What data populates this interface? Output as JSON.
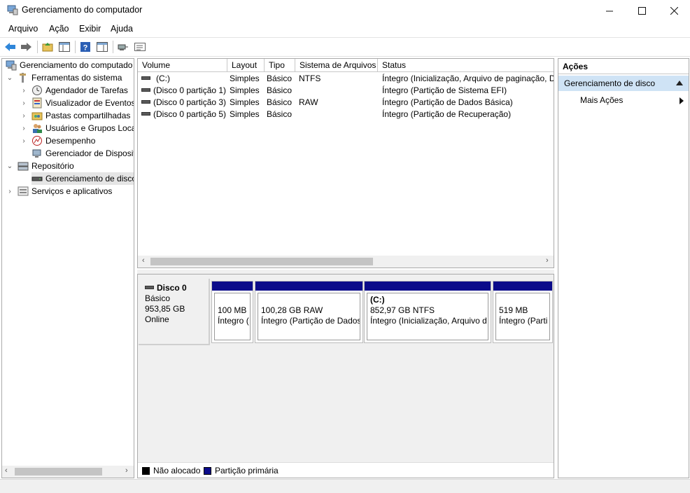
{
  "window": {
    "title": "Gerenciamento do computador",
    "controls": [
      "—",
      "☐",
      "✕"
    ]
  },
  "menu": [
    "Arquivo",
    "Ação",
    "Exibir",
    "Ajuda"
  ],
  "toolbar": {
    "icons": [
      "back-arrow-icon",
      "forward-arrow-icon",
      "up-folder-icon",
      "show-hide-tree-icon",
      "help-icon",
      "show-hide-action-pane-icon",
      "connect-icon",
      "properties-icon"
    ]
  },
  "tree": {
    "root": "Gerenciamento do computador (Local)",
    "root_visible": "Gerenciamento do computado",
    "system_tools": "Ferramentas do sistema",
    "items": [
      "Agendador de Tarefas",
      "Visualizador de Eventos",
      "Pastas compartilhadas",
      "Usuários e Grupos Loca",
      "Desempenho",
      "Gerenciador de Disposit"
    ],
    "storage": "Repositório",
    "disk_management": "Gerenciamento de disco",
    "services": "Serviços e aplicativos"
  },
  "volume_list": {
    "columns": [
      "Volume",
      "Layout",
      "Tipo",
      "Sistema de Arquivos",
      "Status"
    ],
    "rows": [
      [
        "(C:)",
        "Simples",
        "Básico",
        "NTFS",
        "Íntegro (Inicialização, Arquivo de paginação, D"
      ],
      [
        "(Disco 0 partição 1)",
        "Simples",
        "Básico",
        "",
        "Íntegro (Partição de Sistema EFI)"
      ],
      [
        "(Disco 0 partição 3)",
        "Simples",
        "Básico",
        "RAW",
        "Íntegro (Partição de Dados Básica)"
      ],
      [
        "(Disco 0 partição 5)",
        "Simples",
        "Básico",
        "",
        "Íntegro (Partição de Recuperação)"
      ]
    ]
  },
  "disk": {
    "name": "Disco 0",
    "type": "Básico",
    "size": "953,85 GB",
    "status": "Online",
    "partitions": [
      {
        "title": "",
        "size": "100 MB",
        "status": "Íntegro ("
      },
      {
        "title": "",
        "size": "100,28 GB RAW",
        "status": "Íntegro (Partição de Dados"
      },
      {
        "title": "(C:)",
        "size": "852,97 GB NTFS",
        "status": "Íntegro (Inicialização, Arquivo d"
      },
      {
        "title": "",
        "size": "519 MB",
        "status": "Íntegro (Parti"
      }
    ]
  },
  "legend": {
    "unallocated": "Não alocado",
    "primary": "Partição primária",
    "unallocated_color": "#000000",
    "primary_color": "#0b0b8a"
  },
  "actions": {
    "title": "Ações",
    "section": "Gerenciamento de disco",
    "more": "Mais Ações"
  }
}
